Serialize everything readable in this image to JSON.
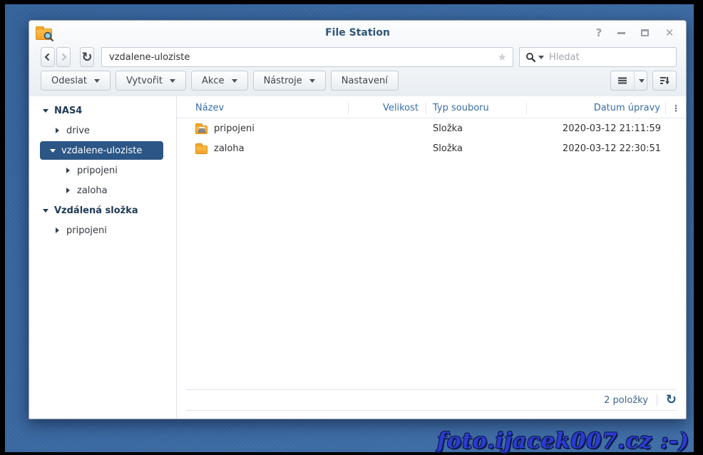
{
  "window": {
    "title": "File Station",
    "controls": {
      "help": "?",
      "close": "✕"
    }
  },
  "navbar": {
    "address_value": "vzdalene-uloziste",
    "search_placeholder": "Hledat"
  },
  "toolbar": {
    "buttons": [
      {
        "label": "Odeslat"
      },
      {
        "label": "Vytvořit"
      },
      {
        "label": "Akce"
      },
      {
        "label": "Nástroje"
      },
      {
        "label": "Nastavení"
      }
    ]
  },
  "sidebar": {
    "items": [
      {
        "label": "NAS4",
        "level": 0,
        "bold": true,
        "expanded": true
      },
      {
        "label": "drive",
        "level": 1,
        "expanded": false
      },
      {
        "label": "vzdalene-uloziste",
        "level": 1,
        "expanded": true,
        "selected": true
      },
      {
        "label": "pripojeni",
        "level": 2,
        "expanded": false
      },
      {
        "label": "zaloha",
        "level": 2,
        "expanded": false
      },
      {
        "label": "Vzdálená složka",
        "level": 0,
        "bold": true,
        "expanded": true
      },
      {
        "label": "pripojeni",
        "level": 1,
        "expanded": false
      }
    ]
  },
  "table": {
    "columns": {
      "name": "Název",
      "size": "Velikost",
      "type": "Typ souboru",
      "modified": "Datum úpravy"
    },
    "rows": [
      {
        "name": "pripojeni",
        "size": "",
        "type": "Složka",
        "modified": "2020-03-12 21:11:59",
        "icon": "shared-folder-icon"
      },
      {
        "name": "zaloha",
        "size": "",
        "type": "Složka",
        "modified": "2020-03-12 22:30:51",
        "icon": "folder-icon"
      }
    ]
  },
  "statusbar": {
    "items_count": "2 položky"
  },
  "watermark": "foto.ijacek007.cz :-)",
  "icons": {
    "star": "★",
    "refresh": "↻",
    "column_options": "⋮"
  },
  "colors": {
    "desktop": "#3a69a2",
    "selected_tree": "#2b5685",
    "header_text": "#3a6ea8",
    "folder_orange": "#f2a12c",
    "title_text": "#2f5578"
  }
}
